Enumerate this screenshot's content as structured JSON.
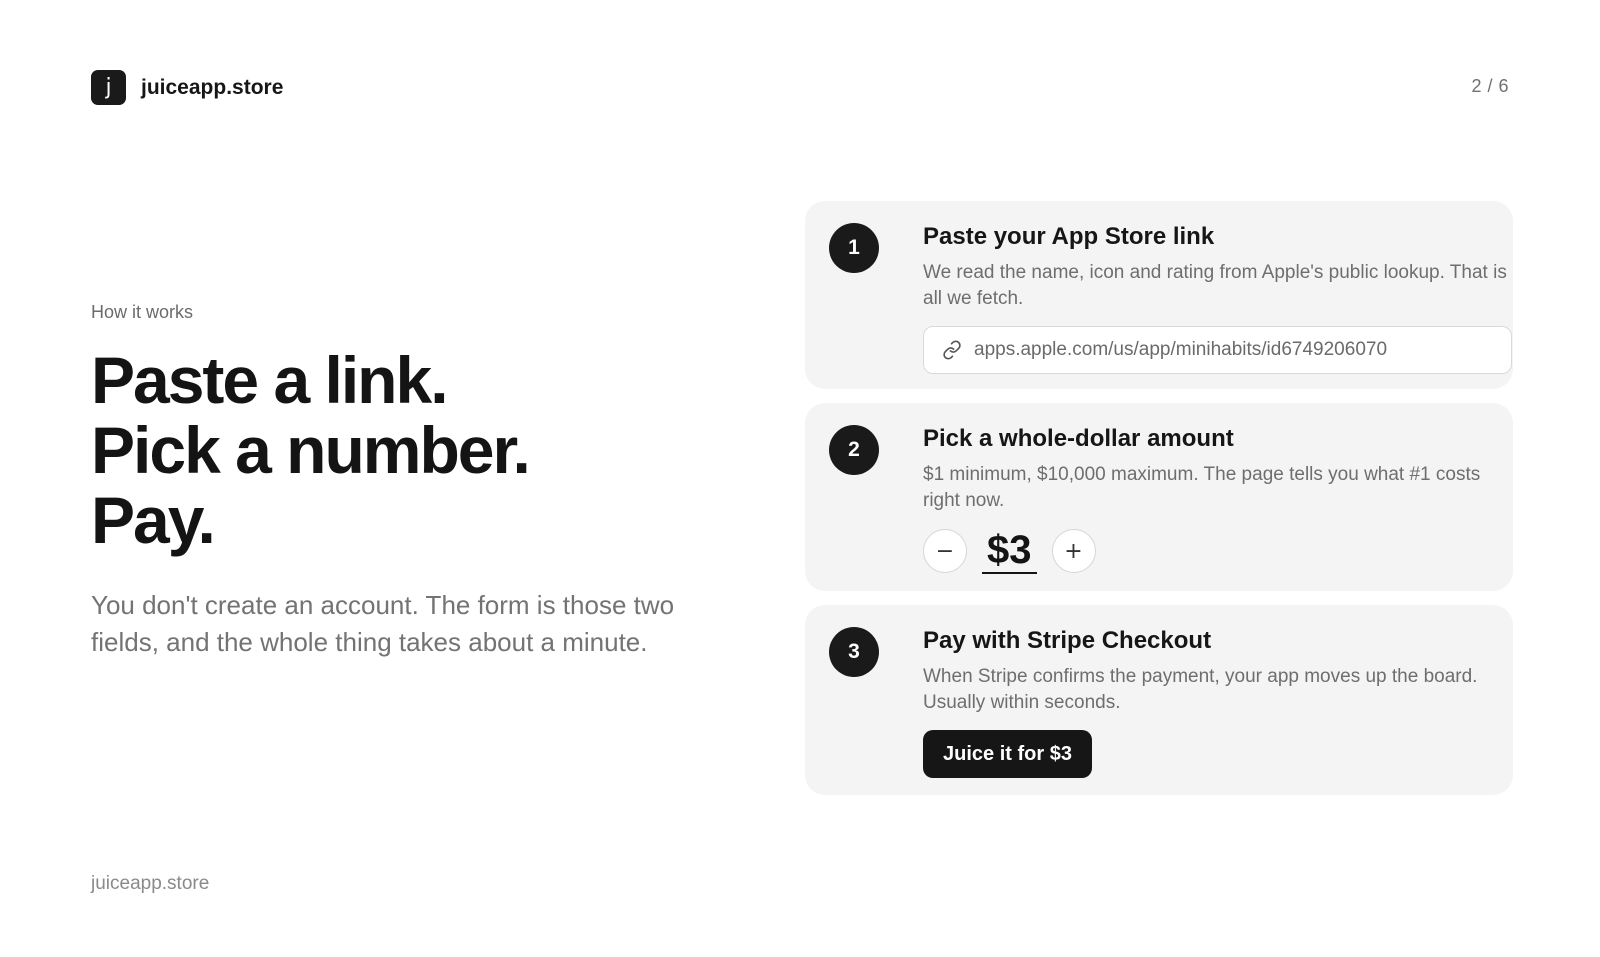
{
  "header": {
    "logo_letter": "j",
    "brand": "juiceapp.store",
    "pager": "2 / 6"
  },
  "intro": {
    "eyebrow": "How it works",
    "headline": [
      "Paste a link.",
      "Pick a number.",
      "Pay."
    ],
    "lead": "You don't create an account. The form is those two fields, and the whole thing takes about a minute."
  },
  "steps": [
    {
      "number": "1",
      "title": "Paste your App Store link",
      "description": "We read the name, icon and rating from Apple's public lookup. That is all we fetch.",
      "url_value": "apps.apple.com/us/app/minihabits/id6749206070",
      "url_icon": "link-icon"
    },
    {
      "number": "2",
      "title": "Pick a whole-dollar amount",
      "description": "$1 minimum, $10,000 maximum. The page tells you what #1 costs right now.",
      "minus_label": "−",
      "amount": "$3",
      "plus_label": "+"
    },
    {
      "number": "3",
      "title": "Pay with Stripe Checkout",
      "description": "When Stripe confirms the payment, your app moves up the board. Usually within seconds.",
      "button_label": "Juice it for $3"
    }
  ],
  "footer": {
    "text": "juiceapp.store"
  },
  "colors": {
    "primary": "#1a1a1a",
    "card_bg": "#f4f4f4",
    "muted_text": "#6e6e6e"
  }
}
